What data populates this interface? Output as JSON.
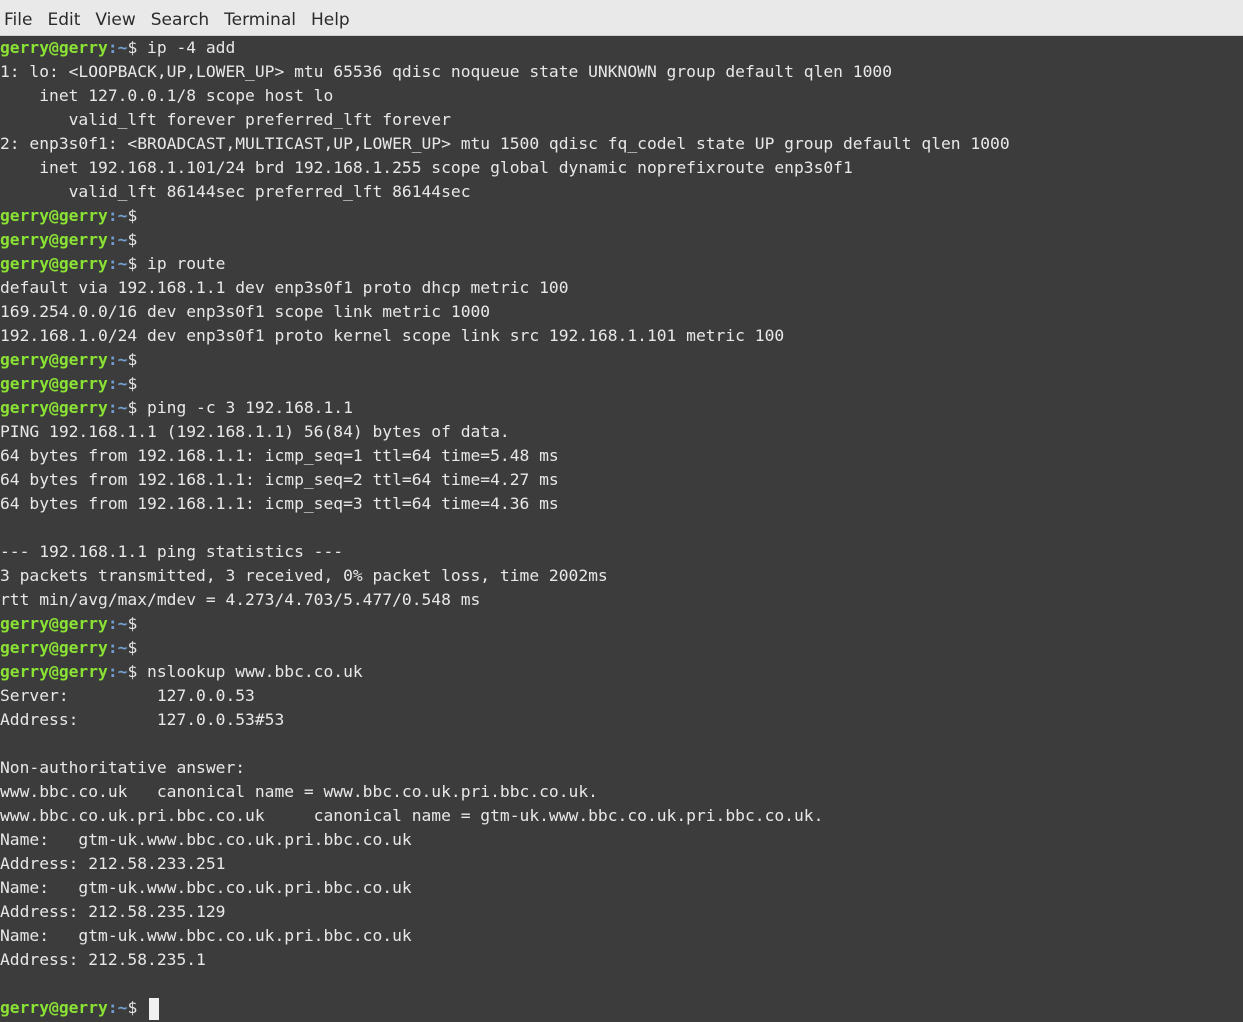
{
  "menu": {
    "items": [
      "File",
      "Edit",
      "View",
      "Search",
      "Terminal",
      "Help"
    ]
  },
  "prompt": {
    "user_host": "gerry@gerry",
    "path": ":~",
    "sign": "$ "
  },
  "lines": [
    {
      "type": "prompt",
      "cmd": "ip -4 add"
    },
    {
      "type": "out",
      "text": "1: lo: <LOOPBACK,UP,LOWER_UP> mtu 65536 qdisc noqueue state UNKNOWN group default qlen 1000"
    },
    {
      "type": "out",
      "text": "    inet 127.0.0.1/8 scope host lo"
    },
    {
      "type": "out",
      "text": "       valid_lft forever preferred_lft forever"
    },
    {
      "type": "out",
      "text": "2: enp3s0f1: <BROADCAST,MULTICAST,UP,LOWER_UP> mtu 1500 qdisc fq_codel state UP group default qlen 1000"
    },
    {
      "type": "out",
      "text": "    inet 192.168.1.101/24 brd 192.168.1.255 scope global dynamic noprefixroute enp3s0f1"
    },
    {
      "type": "out",
      "text": "       valid_lft 86144sec preferred_lft 86144sec"
    },
    {
      "type": "prompt",
      "cmd": ""
    },
    {
      "type": "prompt",
      "cmd": ""
    },
    {
      "type": "prompt",
      "cmd": "ip route"
    },
    {
      "type": "out",
      "text": "default via 192.168.1.1 dev enp3s0f1 proto dhcp metric 100"
    },
    {
      "type": "out",
      "text": "169.254.0.0/16 dev enp3s0f1 scope link metric 1000"
    },
    {
      "type": "out",
      "text": "192.168.1.0/24 dev enp3s0f1 proto kernel scope link src 192.168.1.101 metric 100"
    },
    {
      "type": "prompt",
      "cmd": ""
    },
    {
      "type": "prompt",
      "cmd": ""
    },
    {
      "type": "prompt",
      "cmd": "ping -c 3 192.168.1.1"
    },
    {
      "type": "out",
      "text": "PING 192.168.1.1 (192.168.1.1) 56(84) bytes of data."
    },
    {
      "type": "out",
      "text": "64 bytes from 192.168.1.1: icmp_seq=1 ttl=64 time=5.48 ms"
    },
    {
      "type": "out",
      "text": "64 bytes from 192.168.1.1: icmp_seq=2 ttl=64 time=4.27 ms"
    },
    {
      "type": "out",
      "text": "64 bytes from 192.168.1.1: icmp_seq=3 ttl=64 time=4.36 ms"
    },
    {
      "type": "out",
      "text": ""
    },
    {
      "type": "out",
      "text": "--- 192.168.1.1 ping statistics ---"
    },
    {
      "type": "out",
      "text": "3 packets transmitted, 3 received, 0% packet loss, time 2002ms"
    },
    {
      "type": "out",
      "text": "rtt min/avg/max/mdev = 4.273/4.703/5.477/0.548 ms"
    },
    {
      "type": "prompt",
      "cmd": ""
    },
    {
      "type": "prompt",
      "cmd": ""
    },
    {
      "type": "prompt",
      "cmd": "nslookup www.bbc.co.uk"
    },
    {
      "type": "out",
      "text": "Server:         127.0.0.53"
    },
    {
      "type": "out",
      "text": "Address:        127.0.0.53#53"
    },
    {
      "type": "out",
      "text": ""
    },
    {
      "type": "out",
      "text": "Non-authoritative answer:"
    },
    {
      "type": "out",
      "text": "www.bbc.co.uk   canonical name = www.bbc.co.uk.pri.bbc.co.uk."
    },
    {
      "type": "out",
      "text": "www.bbc.co.uk.pri.bbc.co.uk     canonical name = gtm-uk.www.bbc.co.uk.pri.bbc.co.uk."
    },
    {
      "type": "out",
      "text": "Name:   gtm-uk.www.bbc.co.uk.pri.bbc.co.uk"
    },
    {
      "type": "out",
      "text": "Address: 212.58.233.251"
    },
    {
      "type": "out",
      "text": "Name:   gtm-uk.www.bbc.co.uk.pri.bbc.co.uk"
    },
    {
      "type": "out",
      "text": "Address: 212.58.235.129"
    },
    {
      "type": "out",
      "text": "Name:   gtm-uk.www.bbc.co.uk.pri.bbc.co.uk"
    },
    {
      "type": "out",
      "text": "Address: 212.58.235.1"
    },
    {
      "type": "out",
      "text": ""
    },
    {
      "type": "prompt",
      "cmd": "",
      "cursor": true
    }
  ]
}
